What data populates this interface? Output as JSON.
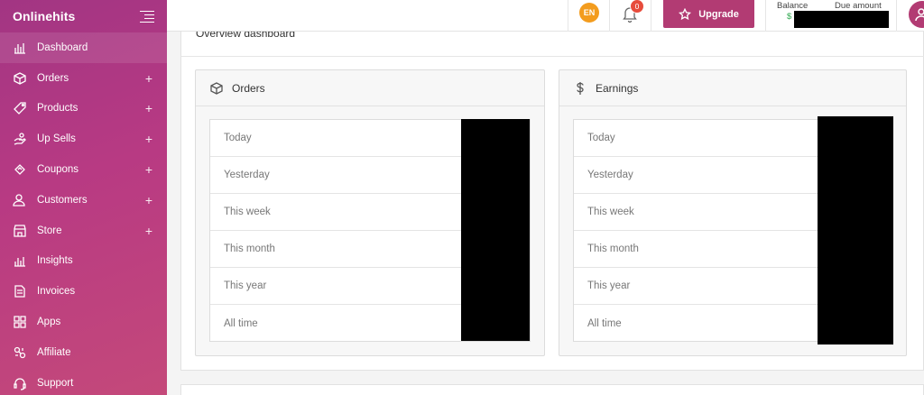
{
  "brand": {
    "name": "Onlinehits"
  },
  "sidebar": {
    "items": [
      {
        "label": "Dashboard",
        "icon": "bar-chart-icon",
        "expandable": false,
        "active": true
      },
      {
        "label": "Orders",
        "icon": "box-icon",
        "expandable": true,
        "plus": "+"
      },
      {
        "label": "Products",
        "icon": "tag-icon",
        "expandable": true,
        "plus": "+"
      },
      {
        "label": "Up Sells",
        "icon": "hand-coin-icon",
        "expandable": true,
        "plus": "+"
      },
      {
        "label": "Coupons",
        "icon": "coupon-icon",
        "expandable": true,
        "plus": "+"
      },
      {
        "label": "Customers",
        "icon": "users-icon",
        "expandable": true,
        "plus": "+"
      },
      {
        "label": "Store",
        "icon": "store-icon",
        "expandable": true,
        "plus": "+"
      },
      {
        "label": "Insights",
        "icon": "insights-icon",
        "expandable": false
      },
      {
        "label": "Invoices",
        "icon": "invoice-icon",
        "expandable": false
      },
      {
        "label": "Apps",
        "icon": "apps-icon",
        "expandable": false
      },
      {
        "label": "Affiliate",
        "icon": "affiliate-icon",
        "expandable": false
      },
      {
        "label": "Support",
        "icon": "headset-icon",
        "expandable": false
      }
    ]
  },
  "topbar": {
    "language": "EN",
    "notifications_count": "0",
    "upgrade_label": "Upgrade",
    "balance_label": "Balance",
    "balance_currency": "$",
    "due_label": "Due amount"
  },
  "main": {
    "title": "Overview dashboard",
    "orders": {
      "title": "Orders",
      "rows": [
        "Today",
        "Yesterday",
        "This week",
        "This month",
        "This year",
        "All time"
      ]
    },
    "earnings": {
      "title": "Earnings",
      "rows": [
        "Today",
        "Yesterday",
        "This week",
        "This month",
        "This year",
        "All time"
      ]
    }
  },
  "colors": {
    "sidebar": "#b23b83",
    "accent": "#b23b73",
    "lang_badge": "#f39c1e",
    "notif_badge": "#e74c3c",
    "balance": "#2ea84f"
  }
}
